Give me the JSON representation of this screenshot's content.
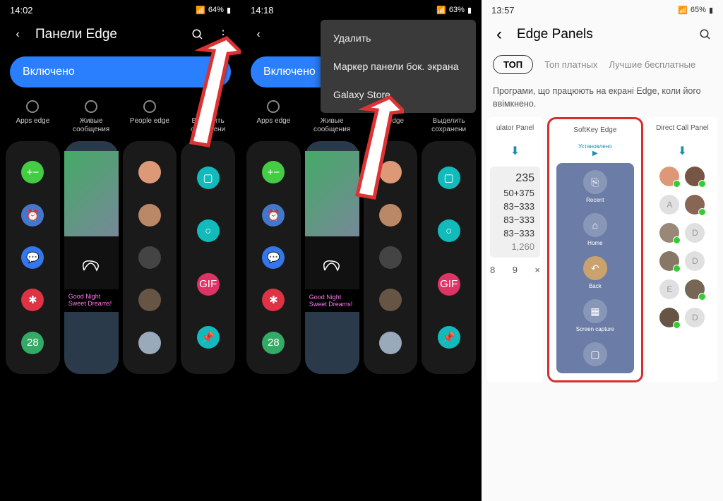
{
  "s1": {
    "time": "14:02",
    "battery": "64%",
    "title": "Панели Edge",
    "toggle": "Включено",
    "panels": [
      "Apps edge",
      "Живые сообщения",
      "People edge",
      "Выделить сохранени"
    ],
    "apps": [
      "+−",
      "⏰",
      "💬",
      "✱",
      "28"
    ],
    "night": "Good Night Sweet Dreams!"
  },
  "s2": {
    "time": "14:18",
    "battery": "63%",
    "toggle": "Включено",
    "menu": [
      "Удалить",
      "Маркер панели бок. экрана",
      "Galaxy Store"
    ],
    "panels": [
      "Apps edge",
      "Живые сообщения",
      "ple edge",
      "Выделить сохранени"
    ]
  },
  "s3": {
    "time": "13:57",
    "battery": "65%",
    "title": "Edge Panels",
    "tabs": [
      "ТОП",
      "Топ платных",
      "Лучшие бесплатные"
    ],
    "desc": "Програми, що працюють на екрані Edge, коли його ввімкнено.",
    "cards": [
      "ulator Panel",
      "SoftKey Edge",
      "Direct Call Panel"
    ],
    "installed": "Установлено",
    "calc": [
      "235",
      "50+375",
      "83−333",
      "83−333",
      "83−333",
      "1,260"
    ],
    "keys": [
      "8",
      "9",
      "×"
    ],
    "softkeys": [
      {
        "icon": "⎘",
        "label": "Recent"
      },
      {
        "icon": "⌂",
        "label": "Home"
      },
      {
        "icon": "↶",
        "label": "Back"
      },
      {
        "icon": "▦",
        "label": "Screen capture"
      },
      {
        "icon": "▢",
        "label": ""
      }
    ],
    "letters": [
      "A",
      "D",
      "E",
      "D"
    ]
  }
}
